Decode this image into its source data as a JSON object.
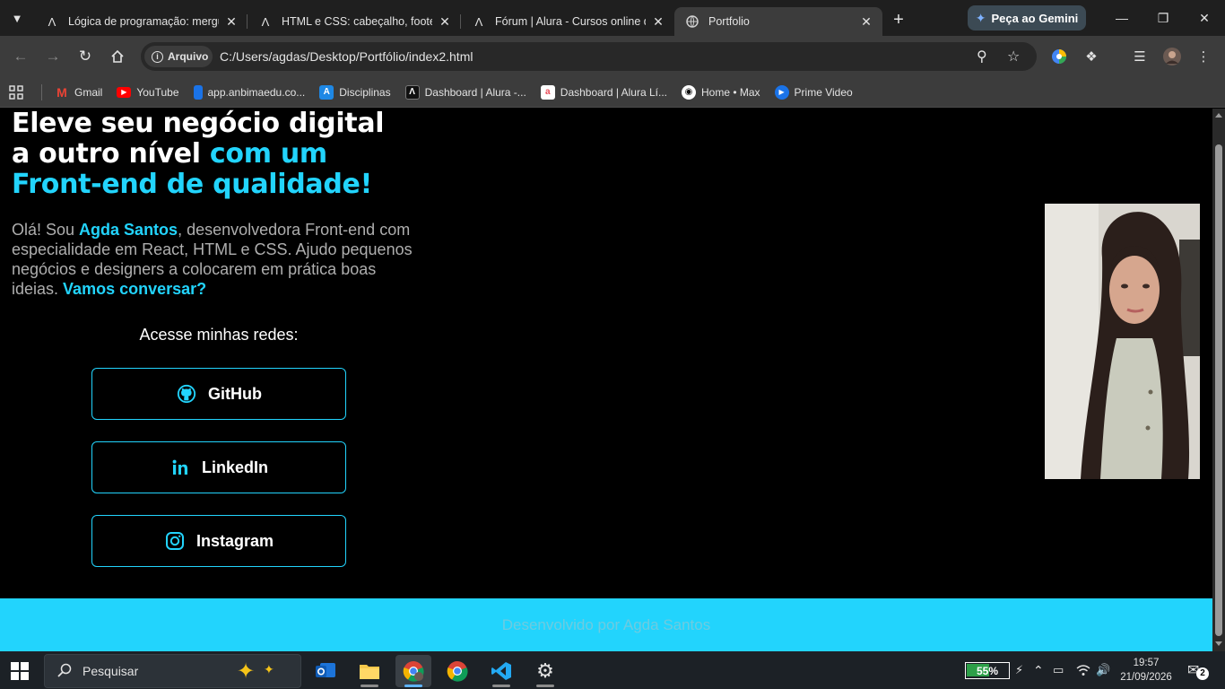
{
  "browser": {
    "tabs": [
      {
        "title": "Lógica de programação: mergu",
        "active": false
      },
      {
        "title": "HTML e CSS: cabeçalho, footer e",
        "active": false
      },
      {
        "title": "Fórum | Alura - Cursos online de",
        "active": false
      },
      {
        "title": "Portfolio",
        "active": true
      }
    ],
    "gemini_label": "Peça ao Gemini",
    "address_chip": "Arquivo",
    "url": "C:/Users/agdas/Desktop/Portfólio/index2.html",
    "bookmarks": [
      {
        "label": "Gmail",
        "icon": "gmail-icon",
        "color": "#ea4335"
      },
      {
        "label": "YouTube",
        "icon": "youtube-icon",
        "color": "#ff0000"
      },
      {
        "label": "app.anbimaedu.co...",
        "icon": "anbima-icon",
        "color": "#1a73e8"
      },
      {
        "label": "Disciplinas",
        "icon": "disciplinas-icon",
        "color": "#1e88e5"
      },
      {
        "label": "Dashboard | Alura -...",
        "icon": "alura-icon",
        "color": "#111111"
      },
      {
        "label": "Dashboard | Alura Lí...",
        "icon": "alura-lingua-icon",
        "color": "#e94c58"
      },
      {
        "label": "Home • Max",
        "icon": "max-icon",
        "color": "#111111"
      },
      {
        "label": "Prime Video",
        "icon": "prime-video-icon",
        "color": "#1a73e8"
      }
    ]
  },
  "page": {
    "headline_line1": "Eleve seu negócio digital",
    "headline_line2a": "a outro nível ",
    "headline_line2b": "com um",
    "headline_line3": "Front-end de qualidade!",
    "intro_1": "Olá! Sou ",
    "intro_name": "Agda Santos",
    "intro_2": ", desenvolvedora Front-end com especialidade em React, HTML e CSS. Ajudo pequenos negócios e designers a colocarem em prática boas ideias. ",
    "intro_cta": "Vamos conversar?",
    "social_heading": "Acesse minhas redes:",
    "social": [
      {
        "label": "GitHub",
        "icon": "github-icon"
      },
      {
        "label": "LinkedIn",
        "icon": "linkedin-icon"
      },
      {
        "label": "Instagram",
        "icon": "instagram-icon"
      }
    ],
    "footer": "Desenvolvido por Agda Santos",
    "accent_color": "#22d4fd"
  },
  "taskbar": {
    "search_placeholder": "Pesquisar",
    "battery_percent": 55,
    "battery_label": "55%",
    "time": "19:57",
    "date": "21/09/2026",
    "notification_count": "2"
  }
}
